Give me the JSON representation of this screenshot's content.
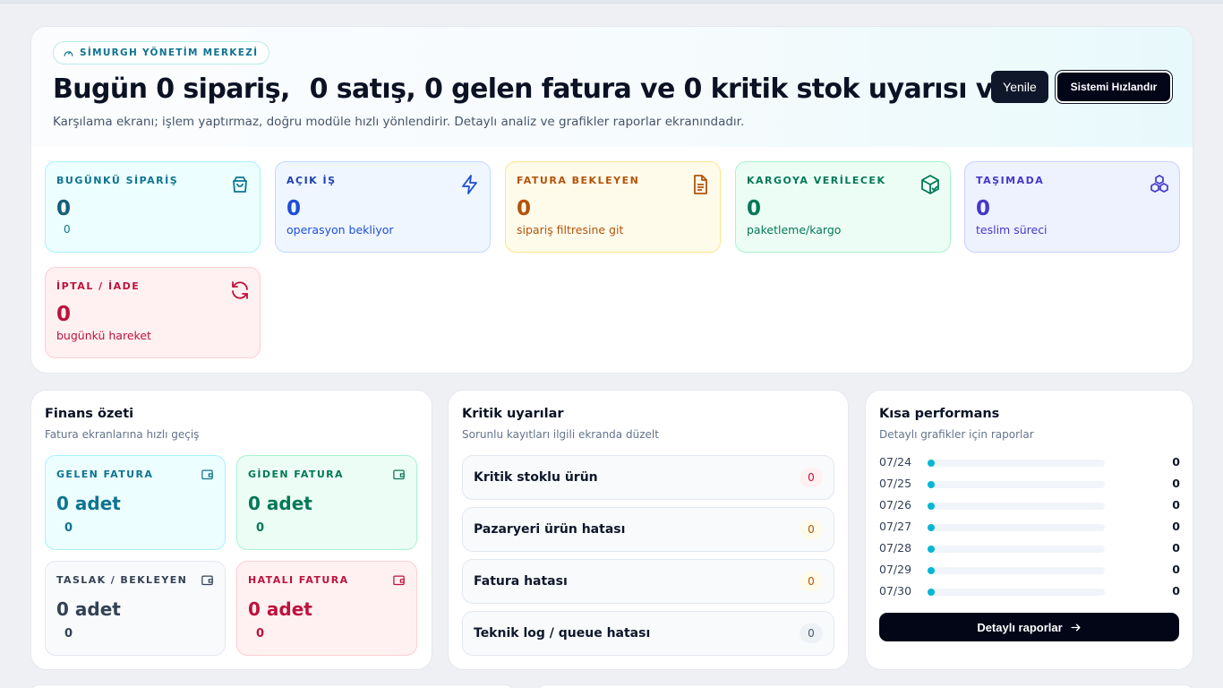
{
  "hero": {
    "badge": "SİMURGH YÖNETİM MERKEZİ",
    "headline_a": "Bugün 0 sipariş,",
    "headline_b": "0 satış, 0 gelen fatura ve 0 kritik stok uyarısı var.",
    "subtitle": "Karşılama ekranı; işlem yaptırmaz, doğru modüle hızlı yönlendirir. Detaylı analiz ve grafikler raporlar ekranındadır.",
    "refresh_label": "Yenile",
    "speed_label": "Sistemi Hızlandır"
  },
  "stats": [
    {
      "label": "BUGÜNKÜ SİPARİŞ",
      "value": "0",
      "note": "0",
      "icon": "shopping-bag-icon"
    },
    {
      "label": "AÇIK İŞ",
      "value": "0",
      "note": "operasyon bekliyor",
      "icon": "lightning-icon"
    },
    {
      "label": "FATURA BEKLEYEN",
      "value": "0",
      "note": "sipariş filtresine git",
      "icon": "document-icon"
    },
    {
      "label": "KARGOYA VERİLECEK",
      "value": "0",
      "note": "paketleme/kargo",
      "icon": "package-check-icon"
    },
    {
      "label": "TAŞIMADA",
      "value": "0",
      "note": "teslim süreci",
      "icon": "boxes-icon"
    },
    {
      "label": "İPTAL / İADE",
      "value": "0",
      "note": "bugünkü hareket",
      "icon": "refresh-icon"
    }
  ],
  "finance": {
    "title": "Finans özeti",
    "subtitle": "Fatura ekranlarına hızlı geçiş",
    "cards": [
      {
        "label": "GELEN FATURA",
        "value": "0 adet",
        "count": "0",
        "icon": "wallet-icon"
      },
      {
        "label": "GİDEN FATURA",
        "value": "0 adet",
        "count": "0",
        "icon": "wallet-icon"
      },
      {
        "label": "TASLAK / BEKLEYEN",
        "value": "0 adet",
        "count": "0",
        "icon": "wallet-icon"
      },
      {
        "label": "HATALI FATURA",
        "value": "0 adet",
        "count": "0",
        "icon": "wallet-icon"
      }
    ]
  },
  "alerts": {
    "title": "Kritik uyarılar",
    "subtitle": "Sorunlu kayıtları ilgili ekranda düzelt",
    "items": [
      {
        "label": "Kritik stoklu ürün",
        "count": "0"
      },
      {
        "label": "Pazaryeri ürün hatası",
        "count": "0"
      },
      {
        "label": "Fatura hatası",
        "count": "0"
      },
      {
        "label": "Teknik log / queue hatası",
        "count": "0"
      }
    ]
  },
  "performance": {
    "title": "Kısa performans",
    "subtitle": "Detaylı grafikler için raporlar",
    "rows": [
      {
        "date": "07/24",
        "value": "0"
      },
      {
        "date": "07/25",
        "value": "0"
      },
      {
        "date": "07/26",
        "value": "0"
      },
      {
        "date": "07/27",
        "value": "0"
      },
      {
        "date": "07/28",
        "value": "0"
      },
      {
        "date": "07/29",
        "value": "0"
      },
      {
        "date": "07/30",
        "value": "0"
      }
    ],
    "button_label": "Detaylı raporlar"
  }
}
